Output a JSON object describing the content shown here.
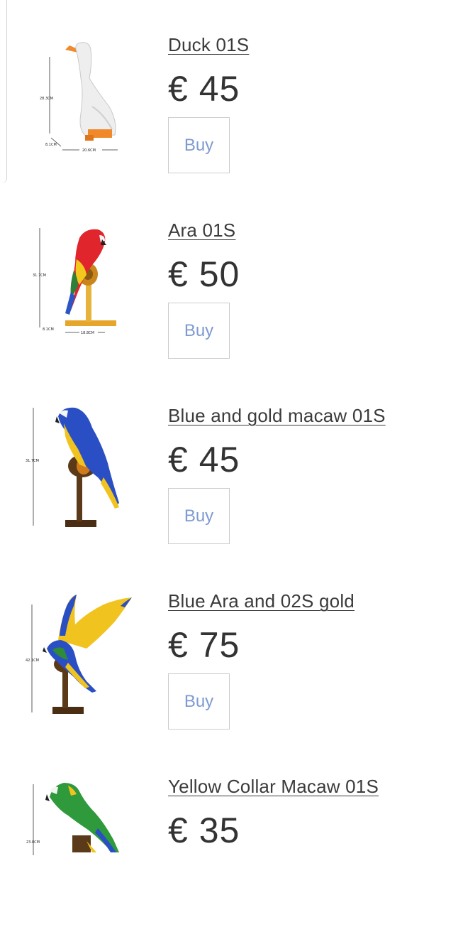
{
  "currency_symbol": "€",
  "buy_label": "Buy",
  "products": [
    {
      "name": "Duck 01S",
      "price": "€ 45",
      "image_icon": "duck-figure-icon",
      "dimensions": [
        "28.3CM",
        "8.1CM",
        "20.6CM"
      ]
    },
    {
      "name": "Ara 01S",
      "price": "€ 50",
      "image_icon": "red-parrot-figure-icon",
      "dimensions": [
        "31.7CM",
        "8.1CM",
        "18.8CM"
      ]
    },
    {
      "name": "Blue and gold macaw 01S",
      "price": "€ 45",
      "image_icon": "blue-gold-macaw-figure-icon",
      "dimensions": [
        "31.7CM"
      ]
    },
    {
      "name": "Blue Ara and 02S gold",
      "price": "€ 75",
      "image_icon": "flying-macaw-figure-icon",
      "dimensions": [
        "42.1CM"
      ]
    },
    {
      "name": "Yellow Collar Macaw 01S",
      "price": "€ 35",
      "image_icon": "green-macaw-figure-icon",
      "dimensions": [
        "23.8CM"
      ]
    }
  ]
}
